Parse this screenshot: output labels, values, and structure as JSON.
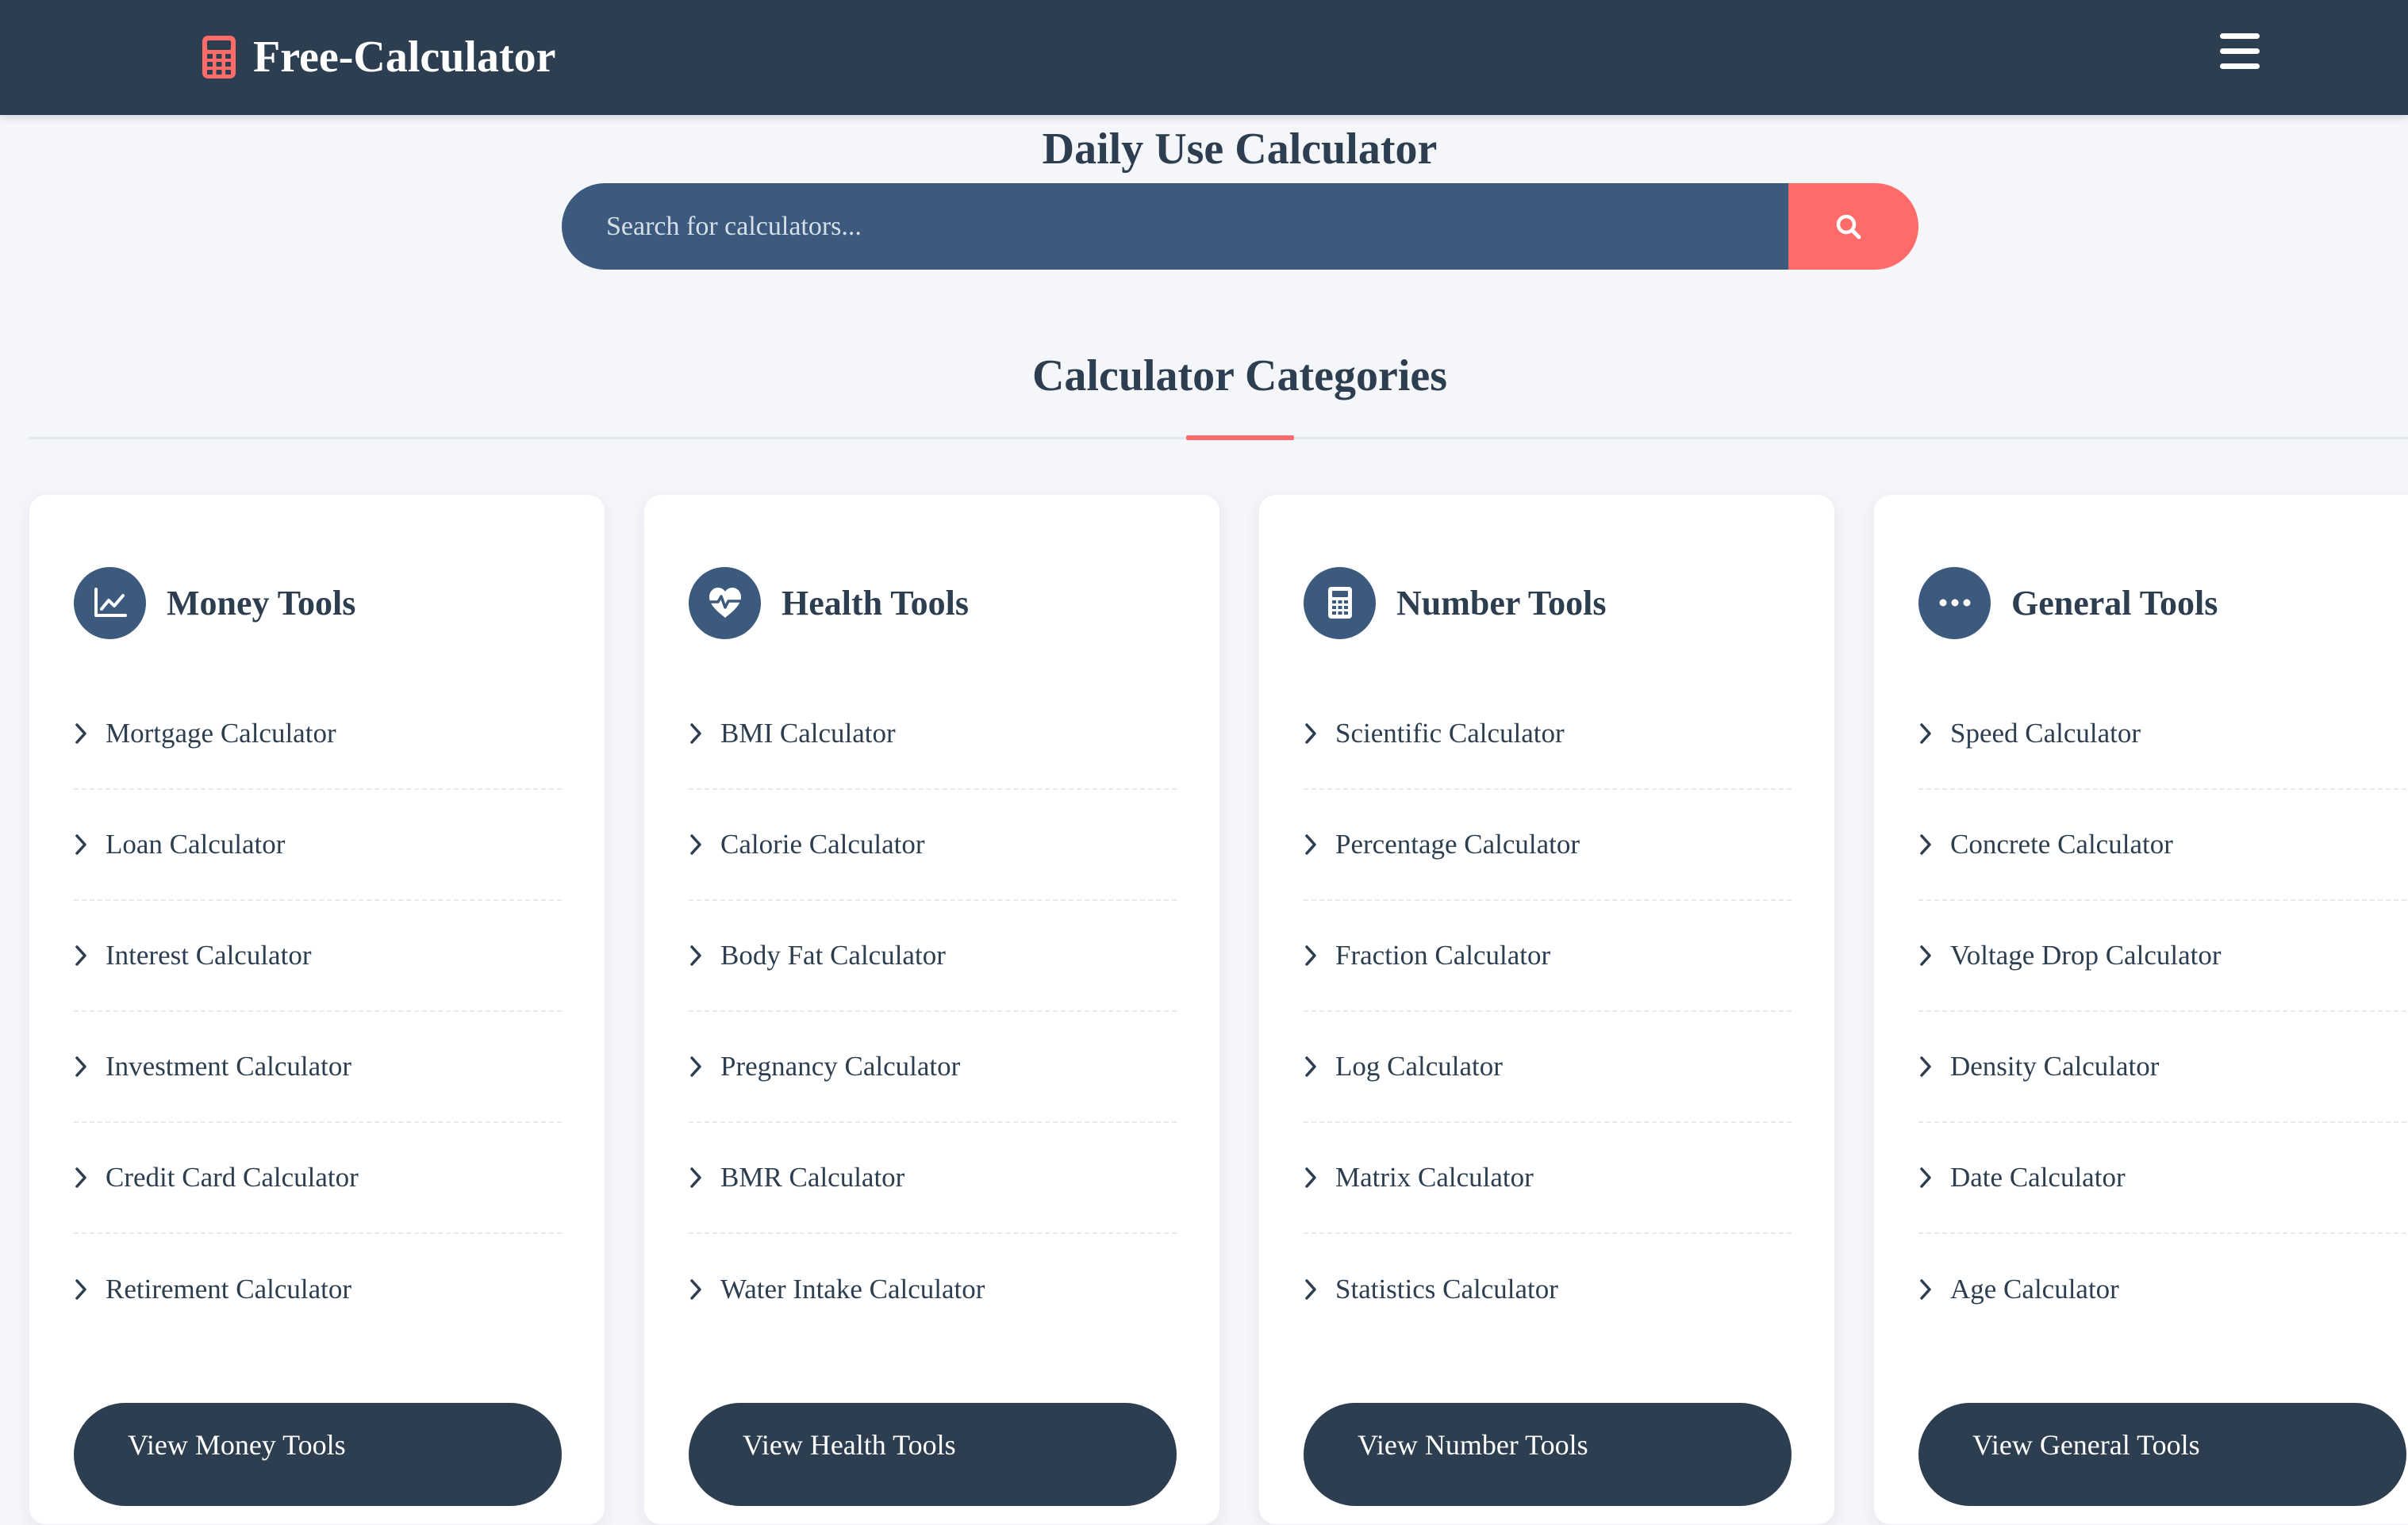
{
  "header": {
    "brand": "Free-Calculator",
    "brand_icon": "calculator-icon",
    "menu_icon": "hamburger-menu-icon"
  },
  "hero": {
    "title": "Daily Use Calculator",
    "search_placeholder": "Search for calculators...",
    "search_icon": "search-icon"
  },
  "section": {
    "title": "Calculator Categories"
  },
  "colors": {
    "navy": "#2d3e50",
    "steel_blue": "#3c5a7e",
    "accent_coral": "#fe6b68",
    "background": "#f5f6fa"
  },
  "categories": [
    {
      "title": "Money Tools",
      "icon": "line-chart-icon",
      "items": [
        "Mortgage Calculator",
        "Loan Calculator",
        "Interest Calculator",
        "Investment Calculator",
        "Credit Card Calculator",
        "Retirement Calculator"
      ],
      "button": "View Money Tools"
    },
    {
      "title": "Health Tools",
      "icon": "heart-pulse-icon",
      "items": [
        "BMI Calculator",
        "Calorie Calculator",
        "Body Fat Calculator",
        "Pregnancy Calculator",
        "BMR Calculator",
        "Water Intake Calculator"
      ],
      "button": "View Health Tools"
    },
    {
      "title": "Number Tools",
      "icon": "calculator-icon",
      "items": [
        "Scientific Calculator",
        "Percentage Calculator",
        "Fraction Calculator",
        "Log Calculator",
        "Matrix Calculator",
        "Statistics Calculator"
      ],
      "button": "View Number Tools"
    },
    {
      "title": "General Tools",
      "icon": "ellipsis-icon",
      "items": [
        "Speed Calculator",
        "Concrete Calculator",
        "Voltage Drop Calculator",
        "Density Calculator",
        "Date Calculator",
        "Age Calculator"
      ],
      "button": "View General Tools"
    }
  ]
}
